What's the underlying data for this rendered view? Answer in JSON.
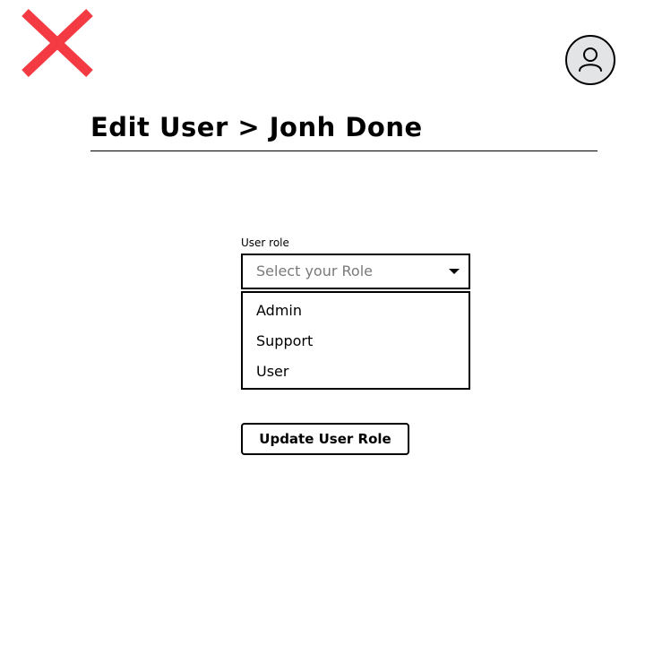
{
  "header": {
    "close_icon": "close-x-icon",
    "close_icon_color": "#f43b43",
    "avatar_icon": "user-avatar-icon",
    "avatar_background": "#e3e4e6",
    "title": "Edit User > Jonh Done"
  },
  "form": {
    "role_label": "User role",
    "role_placeholder": "Select your Role",
    "caret_icon": "caret-down-icon",
    "role_options": [
      "Admin",
      "Support",
      "User"
    ],
    "submit_label": "Update User Role"
  }
}
